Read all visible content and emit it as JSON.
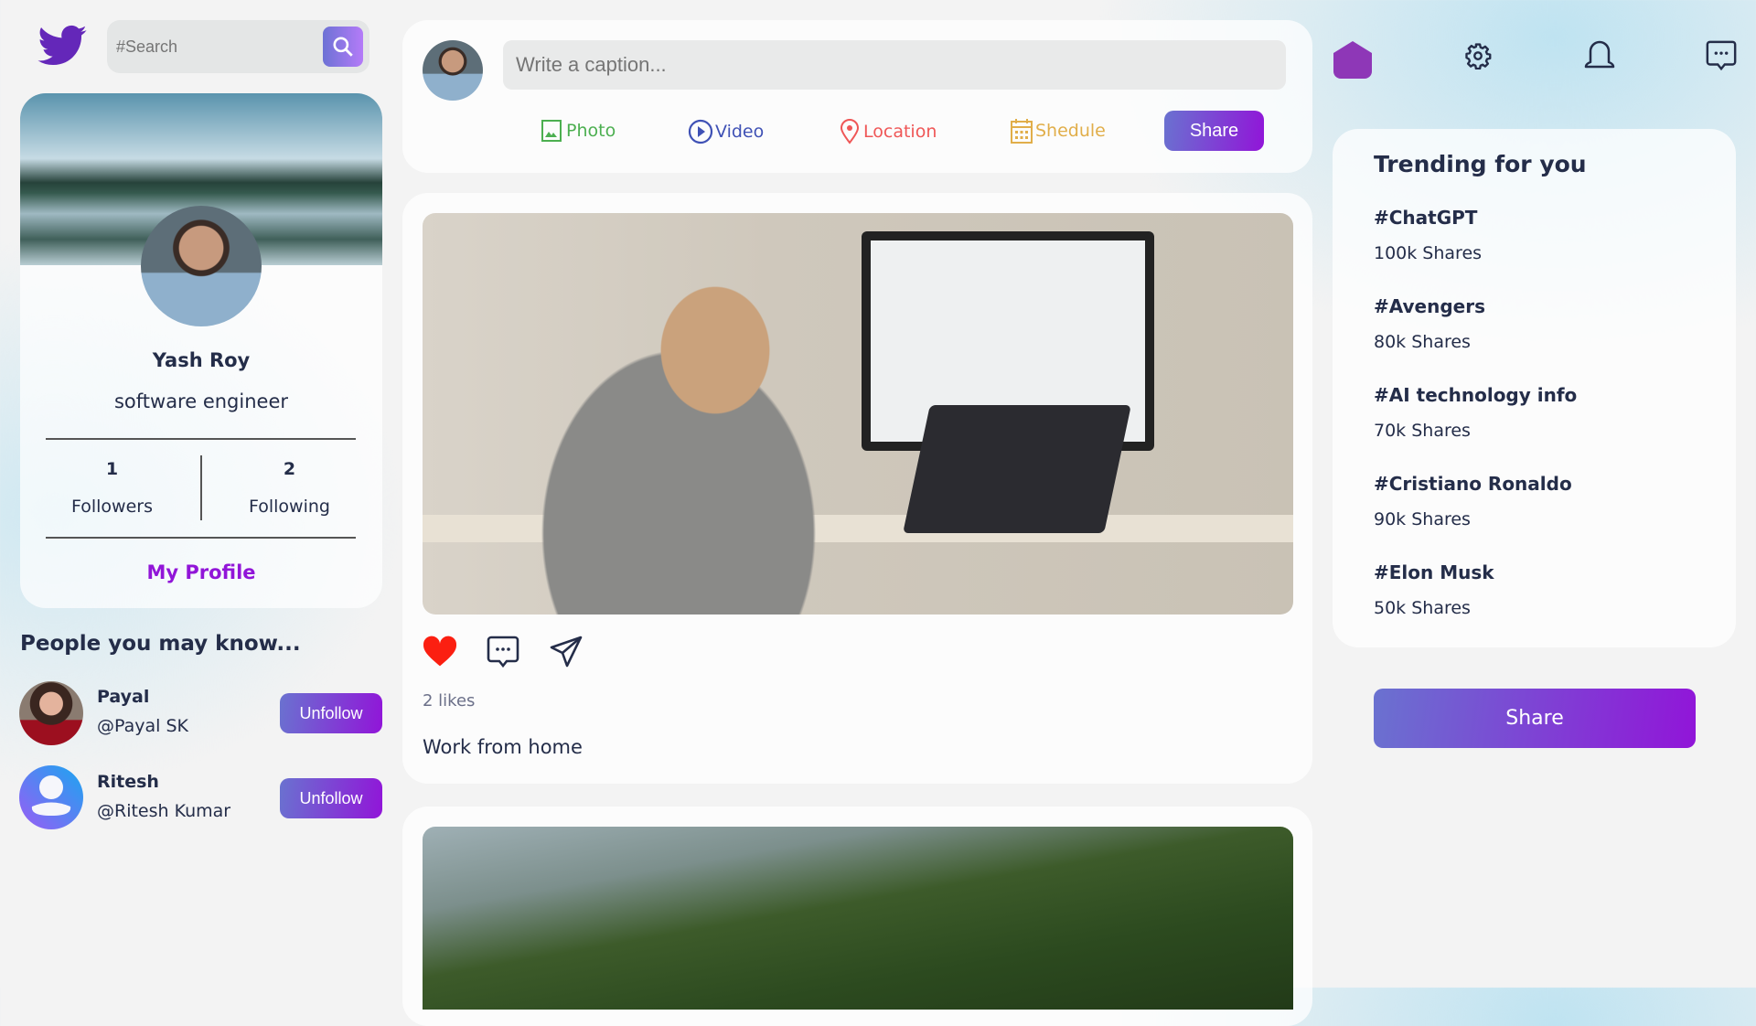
{
  "search": {
    "placeholder": "#Search"
  },
  "profile": {
    "name": "Yash Roy",
    "title": "software engineer",
    "followers_count": "1",
    "followers_label": "Followers",
    "following_count": "2",
    "following_label": "Following",
    "my_profile": "My Profile"
  },
  "people": {
    "heading": "People you may know...",
    "items": [
      {
        "name": "Payal",
        "handle": "@Payal SK",
        "button": "Unfollow"
      },
      {
        "name": "Ritesh",
        "handle": "@Ritesh Kumar",
        "button": "Unfollow"
      }
    ]
  },
  "composer": {
    "placeholder": "Write a caption...",
    "photo": "Photo",
    "video": "Video",
    "location": "Location",
    "schedule": "Shedule",
    "share": "Share"
  },
  "post": {
    "likes": "2 likes",
    "caption": "Work from home"
  },
  "trending": {
    "title": "Trending for you",
    "items": [
      {
        "tag": "#ChatGPT",
        "shares": "100k Shares"
      },
      {
        "tag": "#Avengers",
        "shares": "80k Shares"
      },
      {
        "tag": "#AI technology info",
        "shares": "70k Shares"
      },
      {
        "tag": "#Cristiano Ronaldo",
        "shares": "90k Shares"
      },
      {
        "tag": "#Elon Musk",
        "shares": "50k Shares"
      }
    ]
  },
  "right_share": "Share",
  "colors": {
    "accent": "#9115d8",
    "brand": "#6427b9",
    "photo": "#4caf50",
    "video": "#3f51b5",
    "location": "#ef5757",
    "schedule": "#e1ae4a"
  }
}
